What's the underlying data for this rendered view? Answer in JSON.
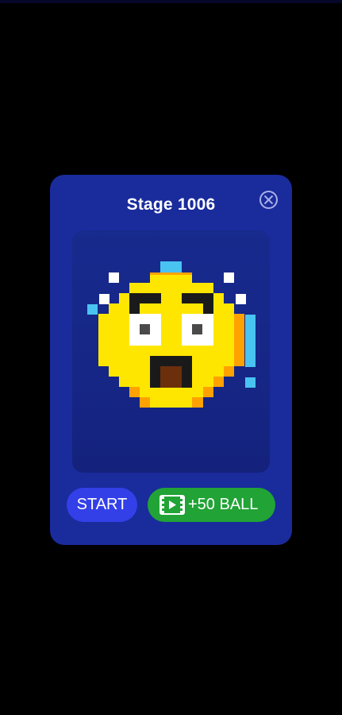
{
  "dialog": {
    "title": "Stage 1006",
    "close_icon": "close-circle-icon"
  },
  "buttons": {
    "start_label": "START",
    "reward_label": "+50 BALL",
    "reward_icon": "video-ad-icon"
  },
  "preview": {
    "subject": "shocked-face-pixel-art"
  },
  "colors": {
    "background": "#000000",
    "dialog": "#1a2b9c",
    "panel": "#172a8d",
    "start_button": "#3340e8",
    "reward_button": "#21a336",
    "face_yellow": "#ffe600",
    "face_orange": "#ffa200",
    "sweat_blue": "#49c3f2"
  }
}
